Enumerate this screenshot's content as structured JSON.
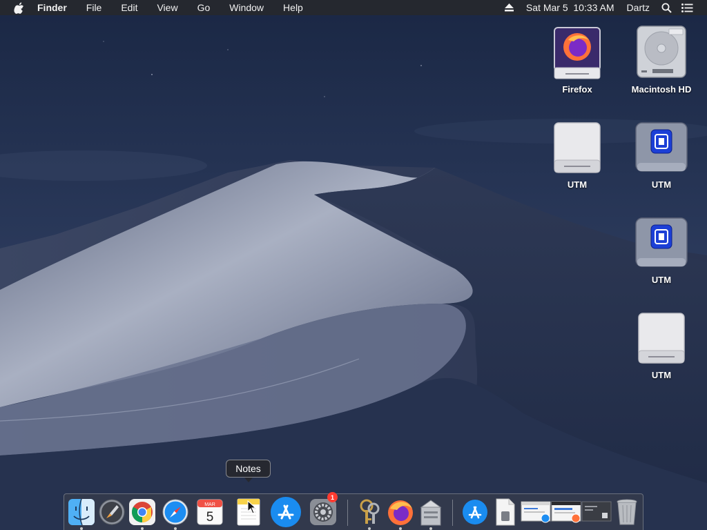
{
  "menubar": {
    "app_name": "Finder",
    "menus": [
      "File",
      "Edit",
      "View",
      "Go",
      "Window",
      "Help"
    ],
    "status": {
      "eject_icon": "eject-icon",
      "datetime": "Sat Mar 5  10:33 AM",
      "user": "Dartz",
      "spotlight_icon": "spotlight-icon",
      "notification_icon": "notification-center-icon"
    }
  },
  "desktop": {
    "icons": [
      {
        "label": "Firefox",
        "kind": "firefox-disk-image-icon"
      },
      {
        "label": "Macintosh HD",
        "kind": "hard-drive-icon"
      },
      {
        "label": "UTM",
        "kind": "external-drive-icon"
      },
      {
        "label": "UTM",
        "kind": "utm-disk-image-icon"
      },
      {
        "label": "UTM",
        "kind": "utm-disk-image-icon"
      },
      {
        "label": "UTM",
        "kind": "external-drive-icon"
      }
    ]
  },
  "dock": {
    "tooltip": "Notes",
    "calendar": {
      "month": "MAR",
      "day": "5"
    },
    "system_preferences_badge": "1",
    "apps": [
      {
        "name": "Finder",
        "icon": "finder-icon",
        "running": true
      },
      {
        "name": "Launchpad",
        "icon": "launchpad-icon",
        "running": false
      },
      {
        "name": "Google Chrome",
        "icon": "chrome-icon",
        "running": true
      },
      {
        "name": "Safari",
        "icon": "safari-icon",
        "running": true
      },
      {
        "name": "Calendar",
        "icon": "calendar-icon",
        "running": false
      },
      {
        "name": "Notes",
        "icon": "notes-icon",
        "running": false
      },
      {
        "name": "App Store",
        "icon": "app-store-icon",
        "running": false
      },
      {
        "name": "System Preferences",
        "icon": "system-preferences-icon",
        "running": false
      },
      {
        "name": "Keychain Access",
        "icon": "keychain-icon",
        "running": true
      },
      {
        "name": "Firefox",
        "icon": "firefox-icon",
        "running": true
      },
      {
        "name": "Installer",
        "icon": "installer-icon",
        "running": true
      },
      {
        "name": "Applications",
        "icon": "applications-folder-icon",
        "running": false
      },
      {
        "name": "Document",
        "icon": "document-icon",
        "running": false
      },
      {
        "name": "Window 1",
        "icon": "minimized-window-icon",
        "running": false
      },
      {
        "name": "Window 2",
        "icon": "minimized-window-icon",
        "running": false
      },
      {
        "name": "Window 3",
        "icon": "minimized-window-icon",
        "running": false
      },
      {
        "name": "Trash",
        "icon": "trash-icon",
        "running": false
      }
    ]
  },
  "colors": {
    "sky_top": "#1c2a47",
    "sky_bottom": "#2b3a5c",
    "dune_light": "#9aa2b8",
    "dune_dark": "#3a4560",
    "badge_red": "#ff3b30"
  }
}
